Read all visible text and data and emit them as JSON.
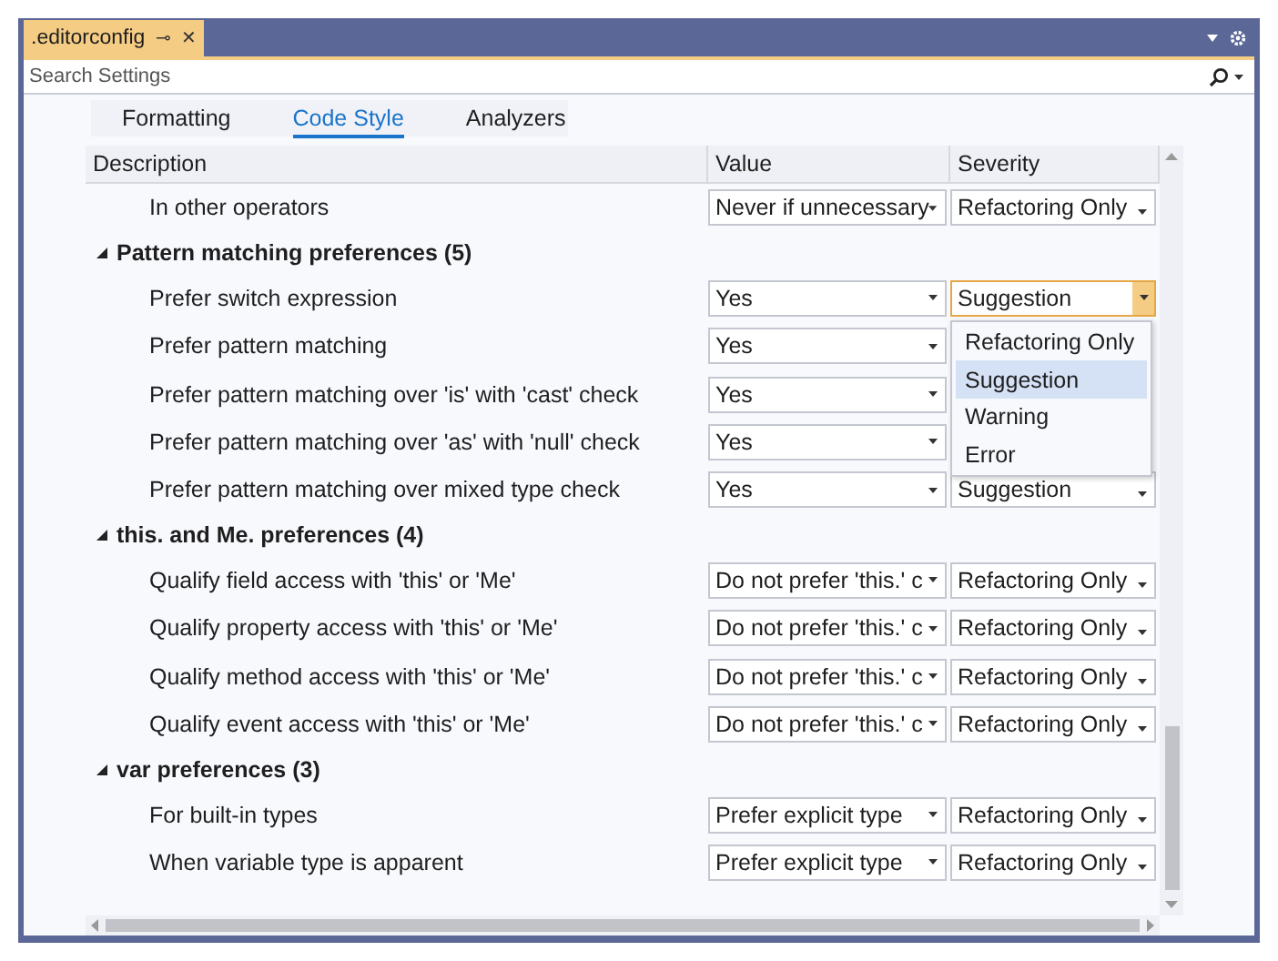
{
  "document_tab": {
    "title": ".editorconfig",
    "pin": "⊸",
    "close": "✕"
  },
  "search": {
    "placeholder": "Search Settings"
  },
  "tabs": [
    {
      "label": "Formatting",
      "selected": false
    },
    {
      "label": "Code Style",
      "selected": true
    },
    {
      "label": "Analyzers",
      "selected": false
    }
  ],
  "table": {
    "columns": [
      "Description",
      "Value",
      "Severity"
    ],
    "leading_rows": [
      {
        "description": "In other operators",
        "value": "Never if unnecessary",
        "severity": "Refactoring Only"
      }
    ],
    "groups": [
      {
        "title": "Pattern matching preferences (5)",
        "expanded": true,
        "rows": [
          {
            "description": "Prefer switch expression",
            "value": "Yes",
            "severity": "Suggestion",
            "open": true
          },
          {
            "description": "Prefer pattern matching",
            "value": "Yes"
          },
          {
            "description": "Prefer pattern matching over 'is' with 'cast' check",
            "value": "Yes"
          },
          {
            "description": "Prefer pattern matching over 'as' with 'null' check",
            "value": "Yes"
          },
          {
            "description": "Prefer pattern matching over mixed type check",
            "value": "Yes",
            "severity": "Suggestion",
            "open": false
          }
        ]
      },
      {
        "title": "this. and Me. preferences (4)",
        "expanded": true,
        "rows": [
          {
            "description": "Qualify field access with 'this' or 'Me'",
            "value": "Do not prefer 'this.' c",
            "severity": "Refactoring Only",
            "open": false
          },
          {
            "description": "Qualify property access with 'this' or 'Me'",
            "value": "Do not prefer 'this.' c",
            "severity": "Refactoring Only",
            "open": false
          },
          {
            "description": "Qualify method access with 'this' or 'Me'",
            "value": "Do not prefer 'this.' c",
            "severity": "Refactoring Only",
            "open": false
          },
          {
            "description": "Qualify event access with 'this' or 'Me'",
            "value": "Do not prefer 'this.' c",
            "severity": "Refactoring Only",
            "open": false
          }
        ]
      },
      {
        "title": "var preferences (3)",
        "expanded": true,
        "rows": [
          {
            "description": "For built-in types",
            "value": "Prefer explicit type",
            "severity": "Refactoring Only",
            "open": false
          },
          {
            "description": "When variable type is apparent",
            "value": "Prefer explicit type",
            "severity": "Refactoring Only",
            "open": false
          }
        ]
      }
    ]
  },
  "severity_menu": {
    "options": [
      {
        "label": "Refactoring Only",
        "selected": false
      },
      {
        "label": "Suggestion",
        "selected": true
      },
      {
        "label": "Warning",
        "selected": false
      },
      {
        "label": "Error",
        "selected": false
      }
    ]
  }
}
